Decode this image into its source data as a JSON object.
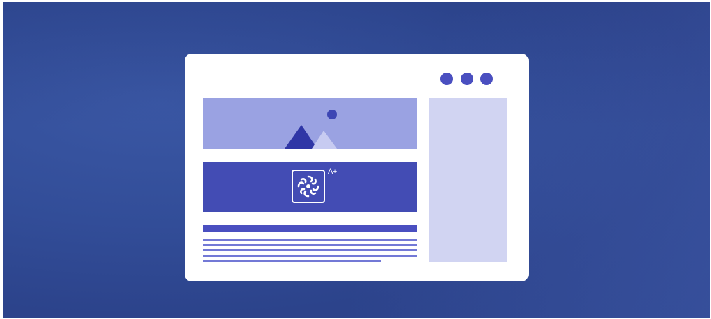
{
  "illustration": {
    "badge_text": "A+",
    "icons": [
      "image-placeholder-icon",
      "gear-logo-icon"
    ],
    "colors": {
      "accent": "#4a4fc0",
      "hero": "#9aa2e2",
      "banner": "#434cb4",
      "sidebar": "#d1d4f2",
      "background": "#2f4a95"
    }
  }
}
